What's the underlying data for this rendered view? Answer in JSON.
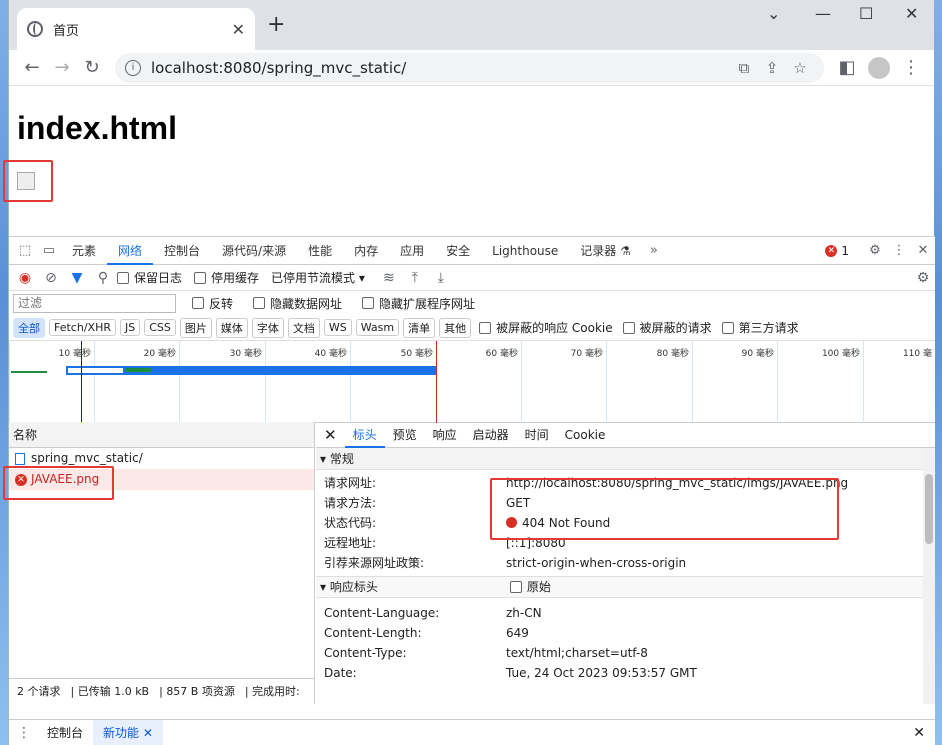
{
  "browser": {
    "tab_title": "首页",
    "new_tab": "+",
    "url": "localhost:8080/spring_mvc_static/",
    "min": "—",
    "max": "☐",
    "close": "✕"
  },
  "page": {
    "heading": "index.html"
  },
  "devtools": {
    "tabs": [
      "元素",
      "网络",
      "控制台",
      "源代码/来源",
      "性能",
      "内存",
      "应用",
      "安全",
      "Lighthouse",
      "记录器 ⚗"
    ],
    "active_tab": "网络",
    "error_count": "1",
    "toolbar": {
      "preserve_log": "保留日志",
      "disable_cache": "停用缓存",
      "throttle": "已停用节流模式"
    },
    "filter": {
      "placeholder": "过滤",
      "invert": "反转",
      "hide_data_urls": "隐藏数据网址",
      "hide_ext_urls": "隐藏扩展程序网址"
    },
    "type_chips": [
      "全部",
      "Fetch/XHR",
      "JS",
      "CSS",
      "图片",
      "媒体",
      "字体",
      "文档",
      "WS",
      "Wasm",
      "清单",
      "其他"
    ],
    "blocked_cookies": "被屏蔽的响应 Cookie",
    "blocked_requests": "被屏蔽的请求",
    "third_party": "第三方请求",
    "timeline_ticks": [
      "10 毫秒",
      "20 毫秒",
      "30 毫秒",
      "40 毫秒",
      "50 毫秒",
      "60 毫秒",
      "70 毫秒",
      "80 毫秒",
      "90 毫秒",
      "100 毫秒",
      "110 毫"
    ],
    "name_header": "名称",
    "requests": [
      "spring_mvc_static/",
      "JAVAEE.png"
    ],
    "status_bar": [
      "2 个请求",
      "已传输 1.0 kB",
      "857 B 项资源",
      "完成用时:"
    ],
    "detail_tabs": [
      "标头",
      "预览",
      "响应",
      "启动器",
      "时间",
      "Cookie"
    ],
    "general": {
      "title": "常规",
      "rows": [
        {
          "k": "请求网址:",
          "v": "http://localhost:8080/spring_mvc_static/imgs/JAVAEE.png"
        },
        {
          "k": "请求方法:",
          "v": "GET"
        },
        {
          "k": "状态代码:",
          "v": "404 Not Found"
        },
        {
          "k": "远程地址:",
          "v": "[::1]:8080"
        },
        {
          "k": "引荐来源网址政策:",
          "v": "strict-origin-when-cross-origin"
        }
      ]
    },
    "response_headers": {
      "title": "响应标头",
      "raw": "原始",
      "rows": [
        {
          "k": "Content-Language:",
          "v": "zh-CN"
        },
        {
          "k": "Content-Length:",
          "v": "649"
        },
        {
          "k": "Content-Type:",
          "v": "text/html;charset=utf-8"
        },
        {
          "k": "Date:",
          "v": "Tue, 24 Oct 2023 09:53:57 GMT"
        }
      ]
    },
    "drawer": [
      "控制台",
      "新功能"
    ]
  }
}
